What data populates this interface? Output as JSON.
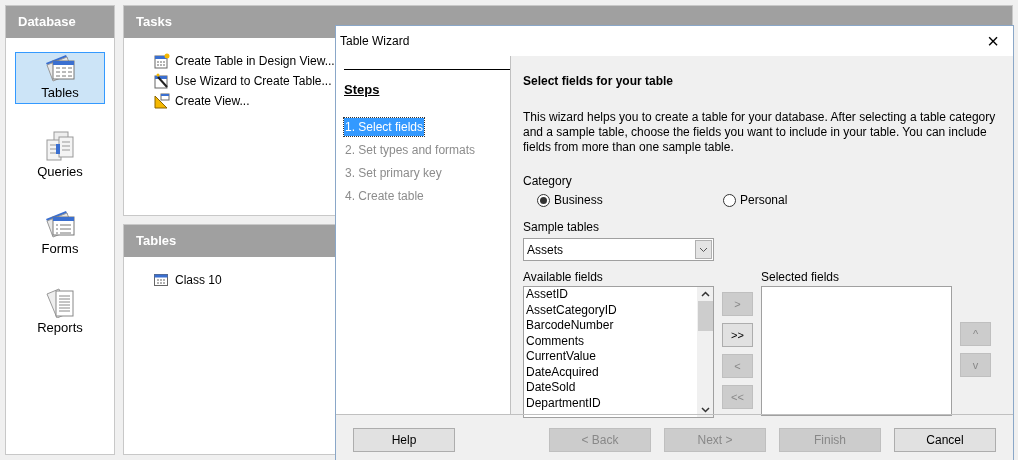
{
  "sidebar": {
    "title": "Database",
    "items": [
      {
        "label": "Tables",
        "kind": "table",
        "selected": true
      },
      {
        "label": "Queries",
        "kind": "query",
        "selected": false
      },
      {
        "label": "Forms",
        "kind": "form",
        "selected": false
      },
      {
        "label": "Reports",
        "kind": "report",
        "selected": false
      }
    ]
  },
  "tasks": {
    "title": "Tasks",
    "items": [
      {
        "label": "Create Table in Design View...",
        "kind": "design"
      },
      {
        "label": "Use Wizard to Create Table...",
        "kind": "wizard"
      },
      {
        "label": "Create View...",
        "kind": "view"
      }
    ]
  },
  "tables": {
    "title": "Tables",
    "items": [
      {
        "label": "Class 10"
      }
    ]
  },
  "dialog": {
    "title": "Table Wizard",
    "close": "×",
    "steps_title": "Steps",
    "steps": [
      {
        "label": "1. Select fields",
        "selected": true,
        "disabled": false
      },
      {
        "label": "2. Set types and formats",
        "selected": false,
        "disabled": true
      },
      {
        "label": "3. Set primary key",
        "selected": false,
        "disabled": true
      },
      {
        "label": "4. Create table",
        "selected": false,
        "disabled": true
      }
    ],
    "heading": "Select fields for your table",
    "description": "This wizard helps you to create a table for your database. After selecting a table category and a sample table, choose the fields you want to include in your table. You can include fields from more than one sample table.",
    "category_label": "Category",
    "categories": [
      {
        "label": "Business",
        "selected": true
      },
      {
        "label": "Personal",
        "selected": false
      }
    ],
    "sample_tables_label": "Sample tables",
    "sample_table": "Assets",
    "available_label": "Available fields",
    "available_fields": [
      "AssetID",
      "AssetCategoryID",
      "BarcodeNumber",
      "Comments",
      "CurrentValue",
      "DateAcquired",
      "DateSold",
      "DepartmentID"
    ],
    "move_buttons": [
      {
        "label": ">",
        "disabled": true
      },
      {
        "label": ">>",
        "disabled": false
      },
      {
        "label": "<",
        "disabled": true
      },
      {
        "label": "<<",
        "disabled": true
      }
    ],
    "selected_label": "Selected fields",
    "order_buttons": [
      {
        "label": "^",
        "disabled": true
      },
      {
        "label": "v",
        "disabled": true
      }
    ],
    "help_button": {
      "label": "Help",
      "disabled": false
    },
    "buttons": [
      {
        "label": "< Back",
        "disabled": true
      },
      {
        "label": "Next >",
        "disabled": true
      },
      {
        "label": "Finish",
        "disabled": true
      },
      {
        "label": "Cancel",
        "disabled": false
      }
    ]
  }
}
